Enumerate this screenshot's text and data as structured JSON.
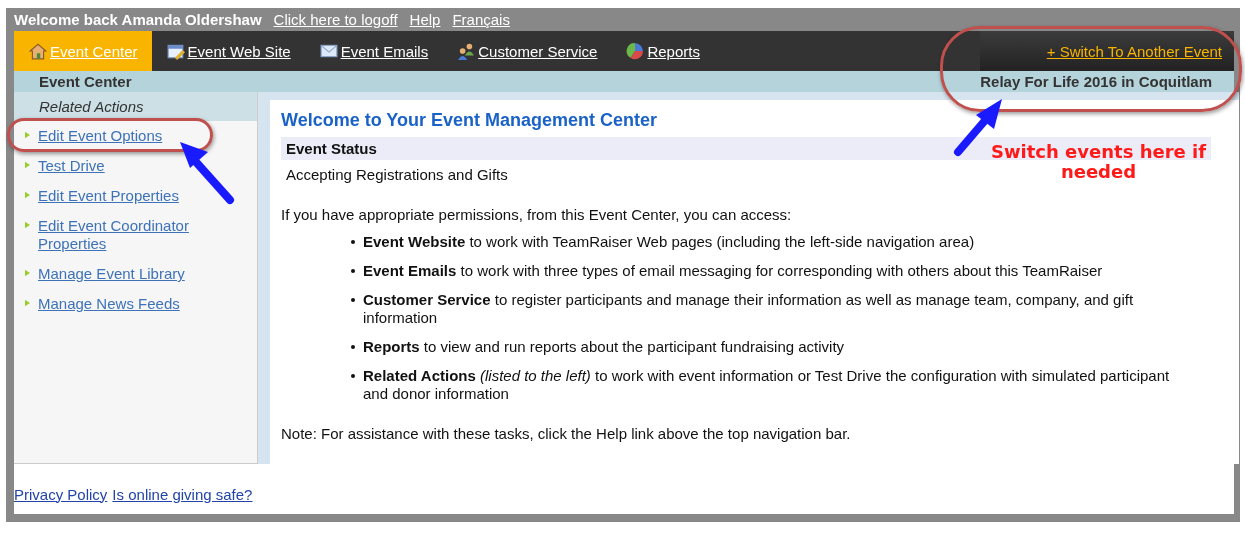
{
  "top_bar": {
    "welcome": "Welcome back Amanda Oldershaw",
    "links": [
      "Click here to logoff",
      "Help",
      "Français"
    ]
  },
  "nav": {
    "tabs": [
      {
        "label": "Event Center",
        "selected": true
      },
      {
        "label": "Event Web Site",
        "selected": false
      },
      {
        "label": "Event Emails",
        "selected": false
      },
      {
        "label": "Customer Service",
        "selected": false
      },
      {
        "label": "Reports",
        "selected": false
      }
    ],
    "switch_link": "+ Switch To Another Event"
  },
  "subheader": {
    "section": "Event Center",
    "event_name": "Relay For Life 2016 in Coquitlam"
  },
  "sidebar": {
    "heading": "Related Actions",
    "items": [
      "Edit Event Options",
      "Test Drive",
      "Edit Event Properties",
      "Edit Event Coordinator Properties",
      "Manage Event Library",
      "Manage News Feeds"
    ]
  },
  "content": {
    "title": "Welcome to Your Event Management Center",
    "status_heading": "Event Status",
    "status": "Accepting Registrations and Gifts",
    "intro": "If you have appropriate permissions, from this Event Center, you can access:",
    "bullets": [
      "**Event Website** to work with TeamRaiser Web pages (including the left-side navigation area)",
      "**Event Emails** to work with three types of email messaging for corresponding with others about this TeamRaiser",
      "**Customer Service** to register participants and manage their information as well as manage team, company, and gift information",
      "**Reports** to view and run reports about the participant fundraising activity",
      "**Related Actions** *(listed to the left)* to work with event information or Test Drive the configuration with simulated participant and donor information"
    ],
    "note": "Note: For assistance with these tasks, click the Help link above the top navigation bar."
  },
  "footer": {
    "links": [
      "Privacy Policy",
      "Is online giving safe?"
    ]
  },
  "annotation": {
    "callout": "Switch events here if needed"
  }
}
